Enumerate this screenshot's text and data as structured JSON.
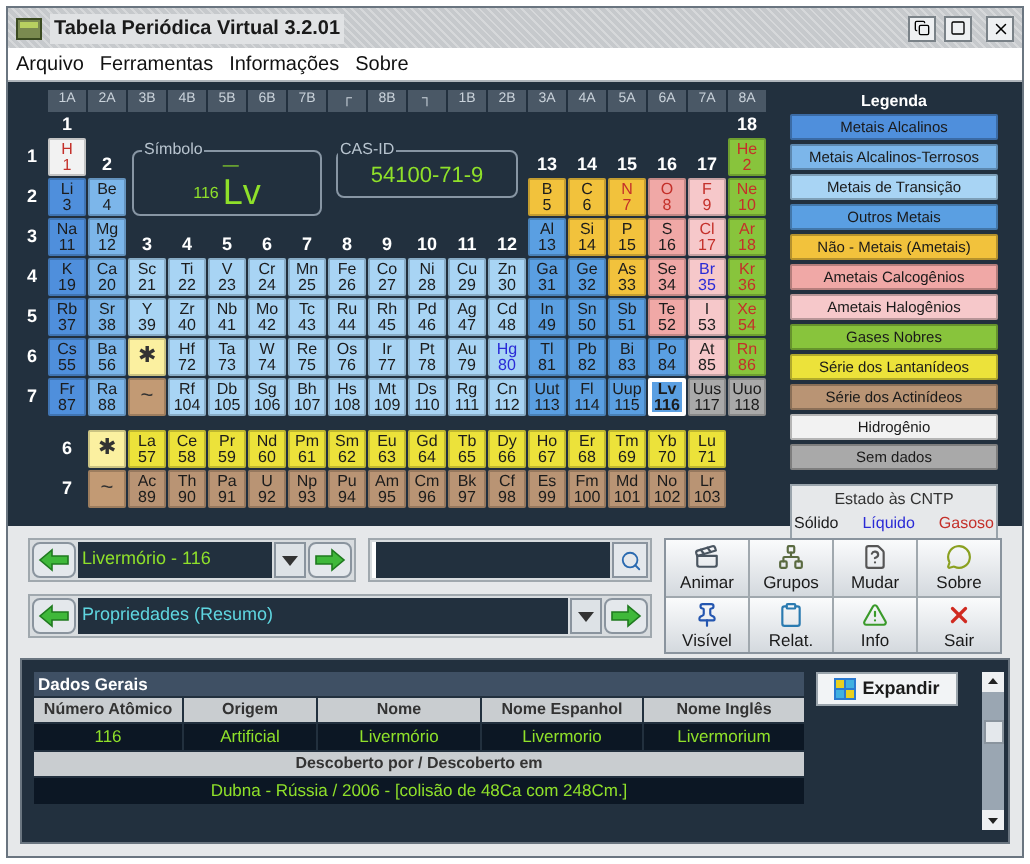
{
  "window": {
    "title": "Tabela Periódica Virtual 3.2.01"
  },
  "menu": [
    "Arquivo",
    "Ferramentas",
    "Informações",
    "Sobre"
  ],
  "table": {
    "group_labels": [
      "1A",
      "2A",
      "3B",
      "4B",
      "5B",
      "6B",
      "7B",
      "┌",
      "8B",
      "┐",
      "1B",
      "2B",
      "3A",
      "4A",
      "5A",
      "6A",
      "7A",
      "8A"
    ],
    "group_numbers": [
      "1",
      "2",
      "3",
      "4",
      "5",
      "6",
      "7",
      "8",
      "9",
      "10",
      "11",
      "12",
      "13",
      "14",
      "15",
      "16",
      "17",
      "18"
    ],
    "symbol_panel": {
      "legend": "Símbolo",
      "mass_number": "—",
      "atomic_number": "116",
      "symbol": "Lv"
    },
    "cas_panel": {
      "legend": "CAS-ID",
      "value": "54100-71-9"
    },
    "periods": [
      {
        "label": "1",
        "cells": [
          {
            "kind": "element",
            "symbol": "H",
            "number": "1",
            "color": "#f2f2f2",
            "gaseous": true,
            "liquid": false,
            "selected": false
          },
          {
            "kind": "element",
            "symbol": "He",
            "number": "2",
            "color": "#88c43c",
            "gaseous": true,
            "liquid": false,
            "selected": false
          }
        ]
      },
      {
        "label": "2",
        "cells": [
          {
            "kind": "element",
            "symbol": "Li",
            "number": "3",
            "color": "#4f8fdc",
            "gaseous": false,
            "liquid": false,
            "selected": false
          },
          {
            "kind": "element",
            "symbol": "Be",
            "number": "4",
            "color": "#7cb6ea",
            "gaseous": false,
            "liquid": false,
            "selected": false
          },
          {
            "kind": "element",
            "symbol": "B",
            "number": "5",
            "color": "#f2c23c",
            "gaseous": false,
            "liquid": false,
            "selected": false
          },
          {
            "kind": "element",
            "symbol": "C",
            "number": "6",
            "color": "#f2c23c",
            "gaseous": false,
            "liquid": false,
            "selected": false
          },
          {
            "kind": "element",
            "symbol": "N",
            "number": "7",
            "color": "#f2c23c",
            "gaseous": true,
            "liquid": false,
            "selected": false
          },
          {
            "kind": "element",
            "symbol": "O",
            "number": "8",
            "color": "#f0a8a6",
            "gaseous": true,
            "liquid": false,
            "selected": false
          },
          {
            "kind": "element",
            "symbol": "F",
            "number": "9",
            "color": "#f6c8ca",
            "gaseous": true,
            "liquid": false,
            "selected": false
          },
          {
            "kind": "element",
            "symbol": "Ne",
            "number": "10",
            "color": "#88c43c",
            "gaseous": true,
            "liquid": false,
            "selected": false
          }
        ]
      },
      {
        "label": "3",
        "cells": [
          {
            "kind": "element",
            "symbol": "Na",
            "number": "11",
            "color": "#4f8fdc",
            "gaseous": false,
            "liquid": false,
            "selected": false
          },
          {
            "kind": "element",
            "symbol": "Mg",
            "number": "12",
            "color": "#7cb6ea",
            "gaseous": false,
            "liquid": false,
            "selected": false
          },
          {
            "kind": "element",
            "symbol": "Al",
            "number": "13",
            "color": "#5a9fe2",
            "gaseous": false,
            "liquid": false,
            "selected": false
          },
          {
            "kind": "element",
            "symbol": "Si",
            "number": "14",
            "color": "#f2c23c",
            "gaseous": false,
            "liquid": false,
            "selected": false
          },
          {
            "kind": "element",
            "symbol": "P",
            "number": "15",
            "color": "#f2c23c",
            "gaseous": false,
            "liquid": false,
            "selected": false
          },
          {
            "kind": "element",
            "symbol": "S",
            "number": "16",
            "color": "#f0a8a6",
            "gaseous": false,
            "liquid": false,
            "selected": false
          },
          {
            "kind": "element",
            "symbol": "Cl",
            "number": "17",
            "color": "#f6c8ca",
            "gaseous": true,
            "liquid": false,
            "selected": false
          },
          {
            "kind": "element",
            "symbol": "Ar",
            "number": "18",
            "color": "#88c43c",
            "gaseous": true,
            "liquid": false,
            "selected": false
          }
        ]
      },
      {
        "label": "4",
        "cells": [
          {
            "kind": "element",
            "symbol": "K",
            "number": "19",
            "color": "#4f8fdc",
            "gaseous": false,
            "liquid": false,
            "selected": false
          },
          {
            "kind": "element",
            "symbol": "Ca",
            "number": "20",
            "color": "#7cb6ea",
            "gaseous": false,
            "liquid": false,
            "selected": false
          },
          {
            "kind": "element",
            "symbol": "Sc",
            "number": "21",
            "color": "#a8d4f4",
            "gaseous": false,
            "liquid": false,
            "selected": false
          },
          {
            "kind": "element",
            "symbol": "Ti",
            "number": "22",
            "color": "#a8d4f4",
            "gaseous": false,
            "liquid": false,
            "selected": false
          },
          {
            "kind": "element",
            "symbol": "V",
            "number": "23",
            "color": "#a8d4f4",
            "gaseous": false,
            "liquid": false,
            "selected": false
          },
          {
            "kind": "element",
            "symbol": "Cr",
            "number": "24",
            "color": "#a8d4f4",
            "gaseous": false,
            "liquid": false,
            "selected": false
          },
          {
            "kind": "element",
            "symbol": "Mn",
            "number": "25",
            "color": "#a8d4f4",
            "gaseous": false,
            "liquid": false,
            "selected": false
          },
          {
            "kind": "element",
            "symbol": "Fe",
            "number": "26",
            "color": "#a8d4f4",
            "gaseous": false,
            "liquid": false,
            "selected": false
          },
          {
            "kind": "element",
            "symbol": "Co",
            "number": "27",
            "color": "#a8d4f4",
            "gaseous": false,
            "liquid": false,
            "selected": false
          },
          {
            "kind": "element",
            "symbol": "Ni",
            "number": "28",
            "color": "#a8d4f4",
            "gaseous": false,
            "liquid": false,
            "selected": false
          },
          {
            "kind": "element",
            "symbol": "Cu",
            "number": "29",
            "color": "#a8d4f4",
            "gaseous": false,
            "liquid": false,
            "selected": false
          },
          {
            "kind": "element",
            "symbol": "Zn",
            "number": "30",
            "color": "#a8d4f4",
            "gaseous": false,
            "liquid": false,
            "selected": false
          },
          {
            "kind": "element",
            "symbol": "Ga",
            "number": "31",
            "color": "#5a9fe2",
            "gaseous": false,
            "liquid": false,
            "selected": false
          },
          {
            "kind": "element",
            "symbol": "Ge",
            "number": "32",
            "color": "#5a9fe2",
            "gaseous": false,
            "liquid": false,
            "selected": false
          },
          {
            "kind": "element",
            "symbol": "As",
            "number": "33",
            "color": "#f2c23c",
            "gaseous": false,
            "liquid": false,
            "selected": false
          },
          {
            "kind": "element",
            "symbol": "Se",
            "number": "34",
            "color": "#f0a8a6",
            "gaseous": false,
            "liquid": false,
            "selected": false
          },
          {
            "kind": "element",
            "symbol": "Br",
            "number": "35",
            "color": "#f6c8ca",
            "gaseous": false,
            "liquid": true,
            "selected": false
          },
          {
            "kind": "element",
            "symbol": "Kr",
            "number": "36",
            "color": "#88c43c",
            "gaseous": true,
            "liquid": false,
            "selected": false
          }
        ]
      },
      {
        "label": "5",
        "cells": [
          {
            "kind": "element",
            "symbol": "Rb",
            "number": "37",
            "color": "#4f8fdc",
            "gaseous": false,
            "liquid": false,
            "selected": false
          },
          {
            "kind": "element",
            "symbol": "Sr",
            "number": "38",
            "color": "#7cb6ea",
            "gaseous": false,
            "liquid": false,
            "selected": false
          },
          {
            "kind": "element",
            "symbol": "Y",
            "number": "39",
            "color": "#a8d4f4",
            "gaseous": false,
            "liquid": false,
            "selected": false
          },
          {
            "kind": "element",
            "symbol": "Zr",
            "number": "40",
            "color": "#a8d4f4",
            "gaseous": false,
            "liquid": false,
            "selected": false
          },
          {
            "kind": "element",
            "symbol": "Nb",
            "number": "41",
            "color": "#a8d4f4",
            "gaseous": false,
            "liquid": false,
            "selected": false
          },
          {
            "kind": "element",
            "symbol": "Mo",
            "number": "42",
            "color": "#a8d4f4",
            "gaseous": false,
            "liquid": false,
            "selected": false
          },
          {
            "kind": "element",
            "symbol": "Tc",
            "number": "43",
            "color": "#a8d4f4",
            "gaseous": false,
            "liquid": false,
            "selected": false
          },
          {
            "kind": "element",
            "symbol": "Ru",
            "number": "44",
            "color": "#a8d4f4",
            "gaseous": false,
            "liquid": false,
            "selected": false
          },
          {
            "kind": "element",
            "symbol": "Rh",
            "number": "45",
            "color": "#a8d4f4",
            "gaseous": false,
            "liquid": false,
            "selected": false
          },
          {
            "kind": "element",
            "symbol": "Pd",
            "number": "46",
            "color": "#a8d4f4",
            "gaseous": false,
            "liquid": false,
            "selected": false
          },
          {
            "kind": "element",
            "symbol": "Ag",
            "number": "47",
            "color": "#a8d4f4",
            "gaseous": false,
            "liquid": false,
            "selected": false
          },
          {
            "kind": "element",
            "symbol": "Cd",
            "number": "48",
            "color": "#a8d4f4",
            "gaseous": false,
            "liquid": false,
            "selected": false
          },
          {
            "kind": "element",
            "symbol": "In",
            "number": "49",
            "color": "#5a9fe2",
            "gaseous": false,
            "liquid": false,
            "selected": false
          },
          {
            "kind": "element",
            "symbol": "Sn",
            "number": "50",
            "color": "#5a9fe2",
            "gaseous": false,
            "liquid": false,
            "selected": false
          },
          {
            "kind": "element",
            "symbol": "Sb",
            "number": "51",
            "color": "#5a9fe2",
            "gaseous": false,
            "liquid": false,
            "selected": false
          },
          {
            "kind": "element",
            "symbol": "Te",
            "number": "52",
            "color": "#f0a8a6",
            "gaseous": false,
            "liquid": false,
            "selected": false
          },
          {
            "kind": "element",
            "symbol": "I",
            "number": "53",
            "color": "#f6c8ca",
            "gaseous": false,
            "liquid": false,
            "selected": false
          },
          {
            "kind": "element",
            "symbol": "Xe",
            "number": "54",
            "color": "#88c43c",
            "gaseous": true,
            "liquid": false,
            "selected": false
          }
        ]
      },
      {
        "label": "6",
        "cells": [
          {
            "kind": "element",
            "symbol": "Cs",
            "number": "55",
            "color": "#4f8fdc",
            "gaseous": false,
            "liquid": false,
            "selected": false
          },
          {
            "kind": "element",
            "symbol": "Ba",
            "number": "56",
            "color": "#7cb6ea",
            "gaseous": false,
            "liquid": false,
            "selected": false
          },
          {
            "kind": "marker",
            "symbol": "✱",
            "color": "#fbf0a0",
            "selected": false
          },
          {
            "kind": "element",
            "symbol": "Hf",
            "number": "72",
            "color": "#a8d4f4",
            "gaseous": false,
            "liquid": false,
            "selected": false
          },
          {
            "kind": "element",
            "symbol": "Ta",
            "number": "73",
            "color": "#a8d4f4",
            "gaseous": false,
            "liquid": false,
            "selected": false
          },
          {
            "kind": "element",
            "symbol": "W",
            "number": "74",
            "color": "#a8d4f4",
            "gaseous": false,
            "liquid": false,
            "selected": false
          },
          {
            "kind": "element",
            "symbol": "Re",
            "number": "75",
            "color": "#a8d4f4",
            "gaseous": false,
            "liquid": false,
            "selected": false
          },
          {
            "kind": "element",
            "symbol": "Os",
            "number": "76",
            "color": "#a8d4f4",
            "gaseous": false,
            "liquid": false,
            "selected": false
          },
          {
            "kind": "element",
            "symbol": "Ir",
            "number": "77",
            "color": "#a8d4f4",
            "gaseous": false,
            "liquid": false,
            "selected": false
          },
          {
            "kind": "element",
            "symbol": "Pt",
            "number": "78",
            "color": "#a8d4f4",
            "gaseous": false,
            "liquid": false,
            "selected": false
          },
          {
            "kind": "element",
            "symbol": "Au",
            "number": "79",
            "color": "#a8d4f4",
            "gaseous": false,
            "liquid": false,
            "selected": false
          },
          {
            "kind": "element",
            "symbol": "Hg",
            "number": "80",
            "color": "#a8d4f4",
            "gaseous": false,
            "liquid": true,
            "selected": false
          },
          {
            "kind": "element",
            "symbol": "Tl",
            "number": "81",
            "color": "#5a9fe2",
            "gaseous": false,
            "liquid": false,
            "selected": false
          },
          {
            "kind": "element",
            "symbol": "Pb",
            "number": "82",
            "color": "#5a9fe2",
            "gaseous": false,
            "liquid": false,
            "selected": false
          },
          {
            "kind": "element",
            "symbol": "Bi",
            "number": "83",
            "color": "#5a9fe2",
            "gaseous": false,
            "liquid": false,
            "selected": false
          },
          {
            "kind": "element",
            "symbol": "Po",
            "number": "84",
            "color": "#5a9fe2",
            "gaseous": false,
            "liquid": false,
            "selected": false
          },
          {
            "kind": "element",
            "symbol": "At",
            "number": "85",
            "color": "#f6c8ca",
            "gaseous": false,
            "liquid": false,
            "selected": false
          },
          {
            "kind": "element",
            "symbol": "Rn",
            "number": "86",
            "color": "#88c43c",
            "gaseous": true,
            "liquid": false,
            "selected": false
          }
        ]
      },
      {
        "label": "7",
        "cells": [
          {
            "kind": "element",
            "symbol": "Fr",
            "number": "87",
            "color": "#4f8fdc",
            "gaseous": false,
            "liquid": false,
            "selected": false
          },
          {
            "kind": "element",
            "symbol": "Ra",
            "number": "88",
            "color": "#7cb6ea",
            "gaseous": false,
            "liquid": false,
            "selected": false
          },
          {
            "kind": "marker",
            "symbol": "~",
            "color": "#c29a74",
            "selected": false
          },
          {
            "kind": "element",
            "symbol": "Rf",
            "number": "104",
            "color": "#a8d4f4",
            "gaseous": false,
            "liquid": false,
            "selected": false
          },
          {
            "kind": "element",
            "symbol": "Db",
            "number": "105",
            "color": "#a8d4f4",
            "gaseous": false,
            "liquid": false,
            "selected": false
          },
          {
            "kind": "element",
            "symbol": "Sg",
            "number": "106",
            "color": "#a8d4f4",
            "gaseous": false,
            "liquid": false,
            "selected": false
          },
          {
            "kind": "element",
            "symbol": "Bh",
            "number": "107",
            "color": "#a8d4f4",
            "gaseous": false,
            "liquid": false,
            "selected": false
          },
          {
            "kind": "element",
            "symbol": "Hs",
            "number": "108",
            "color": "#a8d4f4",
            "gaseous": false,
            "liquid": false,
            "selected": false
          },
          {
            "kind": "element",
            "symbol": "Mt",
            "number": "109",
            "color": "#a8d4f4",
            "gaseous": false,
            "liquid": false,
            "selected": false
          },
          {
            "kind": "element",
            "symbol": "Ds",
            "number": "110",
            "color": "#a8d4f4",
            "gaseous": false,
            "liquid": false,
            "selected": false
          },
          {
            "kind": "element",
            "symbol": "Rg",
            "number": "111",
            "color": "#a8d4f4",
            "gaseous": false,
            "liquid": false,
            "selected": false
          },
          {
            "kind": "element",
            "symbol": "Cn",
            "number": "112",
            "color": "#a8d4f4",
            "gaseous": false,
            "liquid": false,
            "selected": false
          },
          {
            "kind": "element",
            "symbol": "Uut",
            "number": "113",
            "color": "#5a9fe2",
            "gaseous": false,
            "liquid": false,
            "selected": false
          },
          {
            "kind": "element",
            "symbol": "Fl",
            "number": "114",
            "color": "#5a9fe2",
            "gaseous": false,
            "liquid": false,
            "selected": false
          },
          {
            "kind": "element",
            "symbol": "Uup",
            "number": "115",
            "color": "#5a9fe2",
            "gaseous": false,
            "liquid": false,
            "selected": false
          },
          {
            "kind": "element",
            "symbol": "Lv",
            "number": "116",
            "color": "#5a9fe2",
            "gaseous": false,
            "liquid": false,
            "selected": true
          },
          {
            "kind": "element",
            "symbol": "Uus",
            "number": "117",
            "color": "#a9a9a9",
            "gaseous": false,
            "liquid": false,
            "selected": false
          },
          {
            "kind": "element",
            "symbol": "Uuo",
            "number": "118",
            "color": "#a9a9a9",
            "gaseous": false,
            "liquid": false,
            "selected": false
          }
        ]
      }
    ],
    "series": [
      {
        "label": "6",
        "cells": [
          {
            "kind": "marker",
            "symbol": "✱",
            "color": "#fbf0a0",
            "selected": false
          },
          {
            "kind": "element",
            "symbol": "La",
            "number": "57",
            "color": "#ece23a",
            "gaseous": false,
            "liquid": false,
            "selected": false
          },
          {
            "kind": "element",
            "symbol": "Ce",
            "number": "58",
            "color": "#ece23a",
            "gaseous": false,
            "liquid": false,
            "selected": false
          },
          {
            "kind": "element",
            "symbol": "Pr",
            "number": "59",
            "color": "#ece23a",
            "gaseous": false,
            "liquid": false,
            "selected": false
          },
          {
            "kind": "element",
            "symbol": "Nd",
            "number": "60",
            "color": "#ece23a",
            "gaseous": false,
            "liquid": false,
            "selected": false
          },
          {
            "kind": "element",
            "symbol": "Pm",
            "number": "61",
            "color": "#ece23a",
            "gaseous": false,
            "liquid": false,
            "selected": false
          },
          {
            "kind": "element",
            "symbol": "Sm",
            "number": "62",
            "color": "#ece23a",
            "gaseous": false,
            "liquid": false,
            "selected": false
          },
          {
            "kind": "element",
            "symbol": "Eu",
            "number": "63",
            "color": "#ece23a",
            "gaseous": false,
            "liquid": false,
            "selected": false
          },
          {
            "kind": "element",
            "symbol": "Gd",
            "number": "64",
            "color": "#ece23a",
            "gaseous": false,
            "liquid": false,
            "selected": false
          },
          {
            "kind": "element",
            "symbol": "Tb",
            "number": "65",
            "color": "#ece23a",
            "gaseous": false,
            "liquid": false,
            "selected": false
          },
          {
            "kind": "element",
            "symbol": "Dy",
            "number": "66",
            "color": "#ece23a",
            "gaseous": false,
            "liquid": false,
            "selected": false
          },
          {
            "kind": "element",
            "symbol": "Ho",
            "number": "67",
            "color": "#ece23a",
            "gaseous": false,
            "liquid": false,
            "selected": false
          },
          {
            "kind": "element",
            "symbol": "Er",
            "number": "68",
            "color": "#ece23a",
            "gaseous": false,
            "liquid": false,
            "selected": false
          },
          {
            "kind": "element",
            "symbol": "Tm",
            "number": "69",
            "color": "#ece23a",
            "gaseous": false,
            "liquid": false,
            "selected": false
          },
          {
            "kind": "element",
            "symbol": "Yb",
            "number": "70",
            "color": "#ece23a",
            "gaseous": false,
            "liquid": false,
            "selected": false
          },
          {
            "kind": "element",
            "symbol": "Lu",
            "number": "71",
            "color": "#ece23a",
            "gaseous": false,
            "liquid": false,
            "selected": false
          }
        ]
      },
      {
        "label": "7",
        "cells": [
          {
            "kind": "marker",
            "symbol": "~",
            "color": "#c29a74",
            "selected": false
          },
          {
            "kind": "element",
            "symbol": "Ac",
            "number": "89",
            "color": "#b99474",
            "gaseous": false,
            "liquid": false,
            "selected": false
          },
          {
            "kind": "element",
            "symbol": "Th",
            "number": "90",
            "color": "#b99474",
            "gaseous": false,
            "liquid": false,
            "selected": false
          },
          {
            "kind": "element",
            "symbol": "Pa",
            "number": "91",
            "color": "#b99474",
            "gaseous": false,
            "liquid": false,
            "selected": false
          },
          {
            "kind": "element",
            "symbol": "U",
            "number": "92",
            "color": "#b99474",
            "gaseous": false,
            "liquid": false,
            "selected": false
          },
          {
            "kind": "element",
            "symbol": "Np",
            "number": "93",
            "color": "#b99474",
            "gaseous": false,
            "liquid": false,
            "selected": false
          },
          {
            "kind": "element",
            "symbol": "Pu",
            "number": "94",
            "color": "#b99474",
            "gaseous": false,
            "liquid": false,
            "selected": false
          },
          {
            "kind": "element",
            "symbol": "Am",
            "number": "95",
            "color": "#b99474",
            "gaseous": false,
            "liquid": false,
            "selected": false
          },
          {
            "kind": "element",
            "symbol": "Cm",
            "number": "96",
            "color": "#b99474",
            "gaseous": false,
            "liquid": false,
            "selected": false
          },
          {
            "kind": "element",
            "symbol": "Bk",
            "number": "97",
            "color": "#b99474",
            "gaseous": false,
            "liquid": false,
            "selected": false
          },
          {
            "kind": "element",
            "symbol": "Cf",
            "number": "98",
            "color": "#b99474",
            "gaseous": false,
            "liquid": false,
            "selected": false
          },
          {
            "kind": "element",
            "symbol": "Es",
            "number": "99",
            "color": "#b99474",
            "gaseous": false,
            "liquid": false,
            "selected": false
          },
          {
            "kind": "element",
            "symbol": "Fm",
            "number": "100",
            "color": "#b99474",
            "gaseous": false,
            "liquid": false,
            "selected": false
          },
          {
            "kind": "element",
            "symbol": "Md",
            "number": "101",
            "color": "#b99474",
            "gaseous": false,
            "liquid": false,
            "selected": false
          },
          {
            "kind": "element",
            "symbol": "No",
            "number": "102",
            "color": "#b99474",
            "gaseous": false,
            "liquid": false,
            "selected": false
          },
          {
            "kind": "element",
            "symbol": "Lr",
            "number": "103",
            "color": "#b99474",
            "gaseous": false,
            "liquid": false,
            "selected": false
          }
        ]
      }
    ]
  },
  "legend": {
    "title": "Legenda",
    "items": [
      {
        "label": "Metais Alcalinos",
        "color": "#4f8fdc"
      },
      {
        "label": "Metais Alcalinos-Terrosos",
        "color": "#7cb6ea"
      },
      {
        "label": "Metais de Transição",
        "color": "#a8d4f4"
      },
      {
        "label": "Outros Metais",
        "color": "#5a9fe2"
      },
      {
        "label": "Não - Metais (Ametais)",
        "color": "#f2c23c"
      },
      {
        "label": "Ametais Calcogênios",
        "color": "#f0a8a6"
      },
      {
        "label": "Ametais Halogênios",
        "color": "#f6c8ca"
      },
      {
        "label": "Gases Nobres",
        "color": "#88c43c"
      },
      {
        "label": "Série dos Lantanídeos",
        "color": "#ece23a"
      },
      {
        "label": "Série dos Actinídeos",
        "color": "#b99474"
      },
      {
        "label": "Hidrogênio",
        "color": "#f2f2f2"
      },
      {
        "label": "Sem dados",
        "color": "#a9a9a9"
      }
    ]
  },
  "states": {
    "title": "Estado às CNTP",
    "items": [
      {
        "label": "Sólido",
        "color": "#1c1c1c"
      },
      {
        "label": "Líquido",
        "color": "#2a2ad6"
      },
      {
        "label": "Gasoso",
        "color": "#c4302a"
      }
    ]
  },
  "element_selector": {
    "value": "Livermório - 116"
  },
  "view_selector": {
    "value": "Propriedades (Resumo)"
  },
  "toolbar": [
    "Animar",
    "Grupos",
    "Mudar",
    "Sobre",
    "Visível",
    "Relat.",
    "Info",
    "Sair"
  ],
  "details": {
    "title": "Dados Gerais",
    "expand_button": "Expandir",
    "columns": [
      "Número Atômico",
      "Origem",
      "Nome",
      "Nome Espanhol",
      "Nome Inglês"
    ],
    "row": [
      "116",
      "Artificial",
      "Livermório",
      "Livermorio",
      "Livermorium"
    ],
    "discovery_heading": "Descoberto por / Descoberto em",
    "discovery": "Dubna - Rússia / 2006 - [colisão de 48Ca com 248Cm.]"
  }
}
